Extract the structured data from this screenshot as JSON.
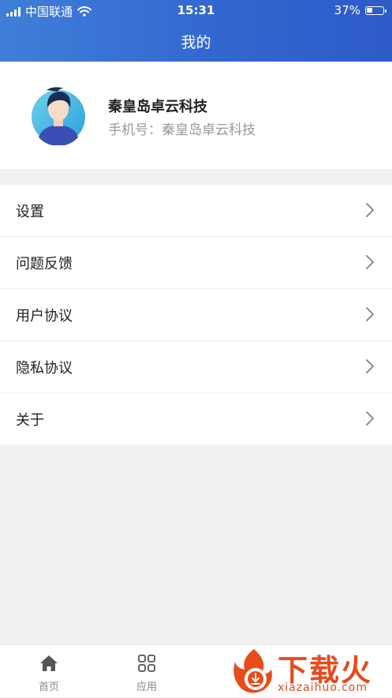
{
  "status_bar": {
    "carrier": "中国联通",
    "time": "15:31",
    "battery_text": "37%",
    "battery_level": 0.37
  },
  "nav": {
    "title": "我的"
  },
  "profile": {
    "name": "秦皇岛卓云科技",
    "phone_line": "手机号：秦皇岛卓云科技"
  },
  "menu": {
    "items": [
      {
        "label": "设置"
      },
      {
        "label": "问题反馈"
      },
      {
        "label": "用户协议"
      },
      {
        "label": "隐私协议"
      },
      {
        "label": "关于"
      }
    ]
  },
  "tabbar": {
    "tabs": [
      {
        "label": "首页",
        "icon": "home-icon"
      },
      {
        "label": "应用",
        "icon": "grid-icon"
      }
    ]
  },
  "watermark": {
    "title": "下载火",
    "domain": "xiazaihuo.com"
  },
  "colors": {
    "header_start": "#3f7fd8",
    "header_end": "#2d5bc8",
    "watermark": "#e84b1c"
  }
}
